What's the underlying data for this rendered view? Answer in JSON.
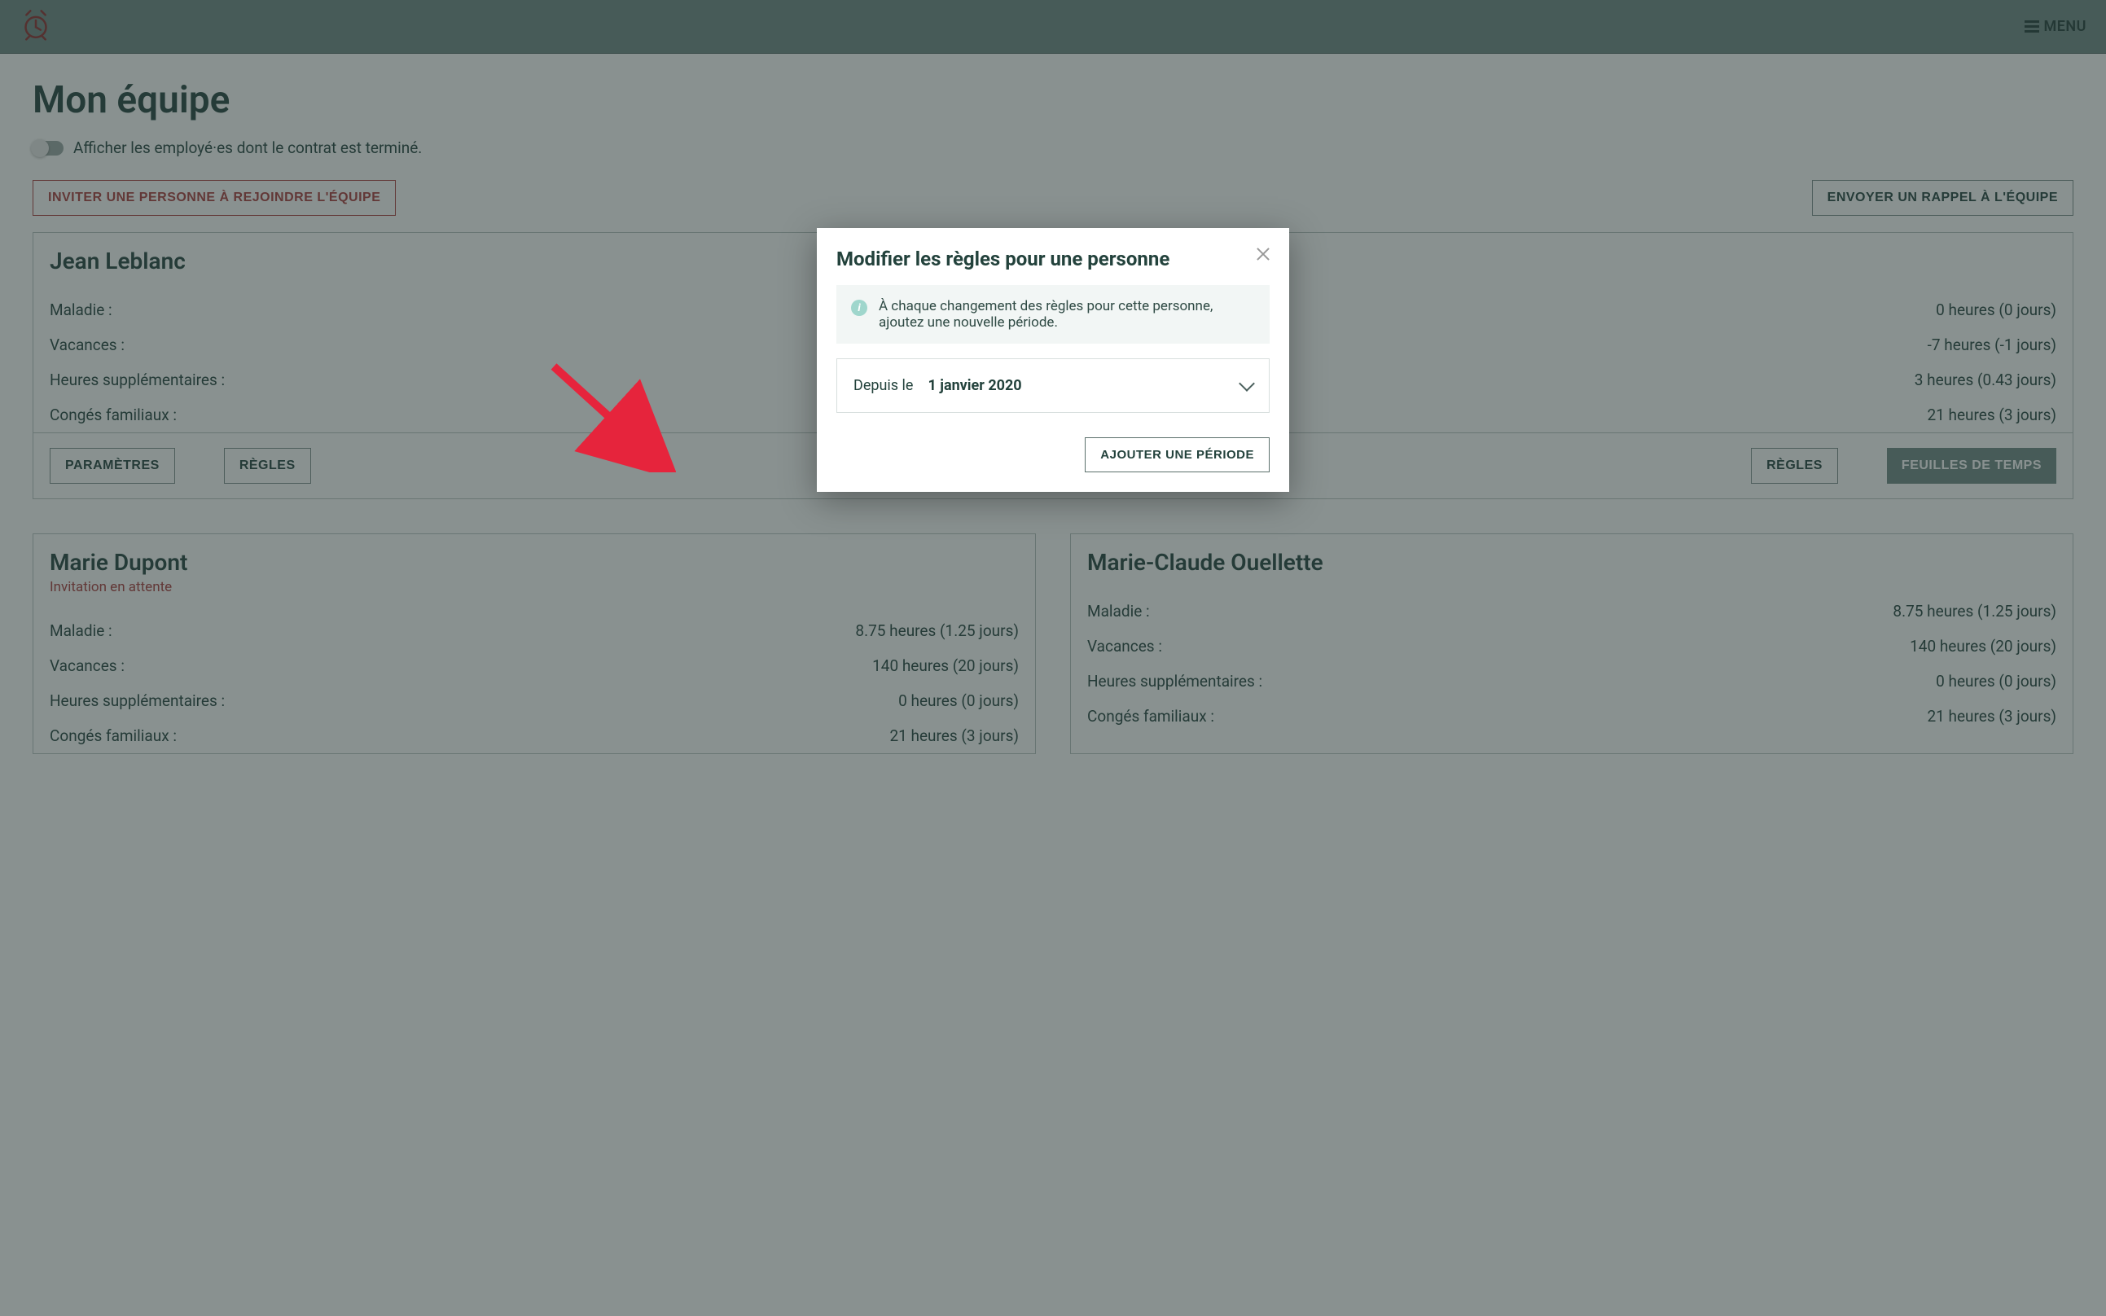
{
  "header": {
    "menu_label": "MENU"
  },
  "page": {
    "title": "Mon équipe",
    "toggle_label": "Afficher les employé·es dont le contrat est terminé.",
    "invite_button": "INVITER UNE PERSONNE À REJOINDRE L'ÉQUIPE",
    "remind_button": "ENVOYER UN RAPPEL À L'ÉQUIPE"
  },
  "labels": {
    "sickness": "Maladie :",
    "vacation": "Vacances :",
    "overtime": "Heures supplémentaires :",
    "family_leave": "Congés familiaux :",
    "params": "PARAMÈTRES",
    "rules": "RÈGLES",
    "timesheets": "FEUILLES DE TEMPS",
    "invite_pending": "Invitation en attente"
  },
  "employees": [
    {
      "name": "Jean Leblanc",
      "pending": false,
      "sickness": "0 heures (0 jours)",
      "vacation": "-7 heures (-1 jours)",
      "overtime": "3 heures (0.43 jours)",
      "family_leave": "21 heures (3 jours)"
    },
    {
      "name": "Marie Dupont",
      "pending": true,
      "sickness": "8.75 heures (1.25 jours)",
      "vacation": "140 heures (20 jours)",
      "overtime": "0 heures (0 jours)",
      "family_leave": "21 heures (3 jours)"
    },
    {
      "name": "Marie-Claude Ouellette",
      "pending": false,
      "sickness": "8.75 heures (1.25 jours)",
      "vacation": "140 heures (20 jours)",
      "overtime": "0 heures (0 jours)",
      "family_leave": "21 heures (3 jours)"
    }
  ],
  "modal": {
    "title": "Modifier les règles pour une personne",
    "info_text": "À chaque changement des règles pour cette personne, ajoutez une nouvelle période.",
    "since_label": "Depuis le",
    "since_date": "1 janvier 2020",
    "add_period_button": "AJOUTER UNE PÉRIODE"
  }
}
